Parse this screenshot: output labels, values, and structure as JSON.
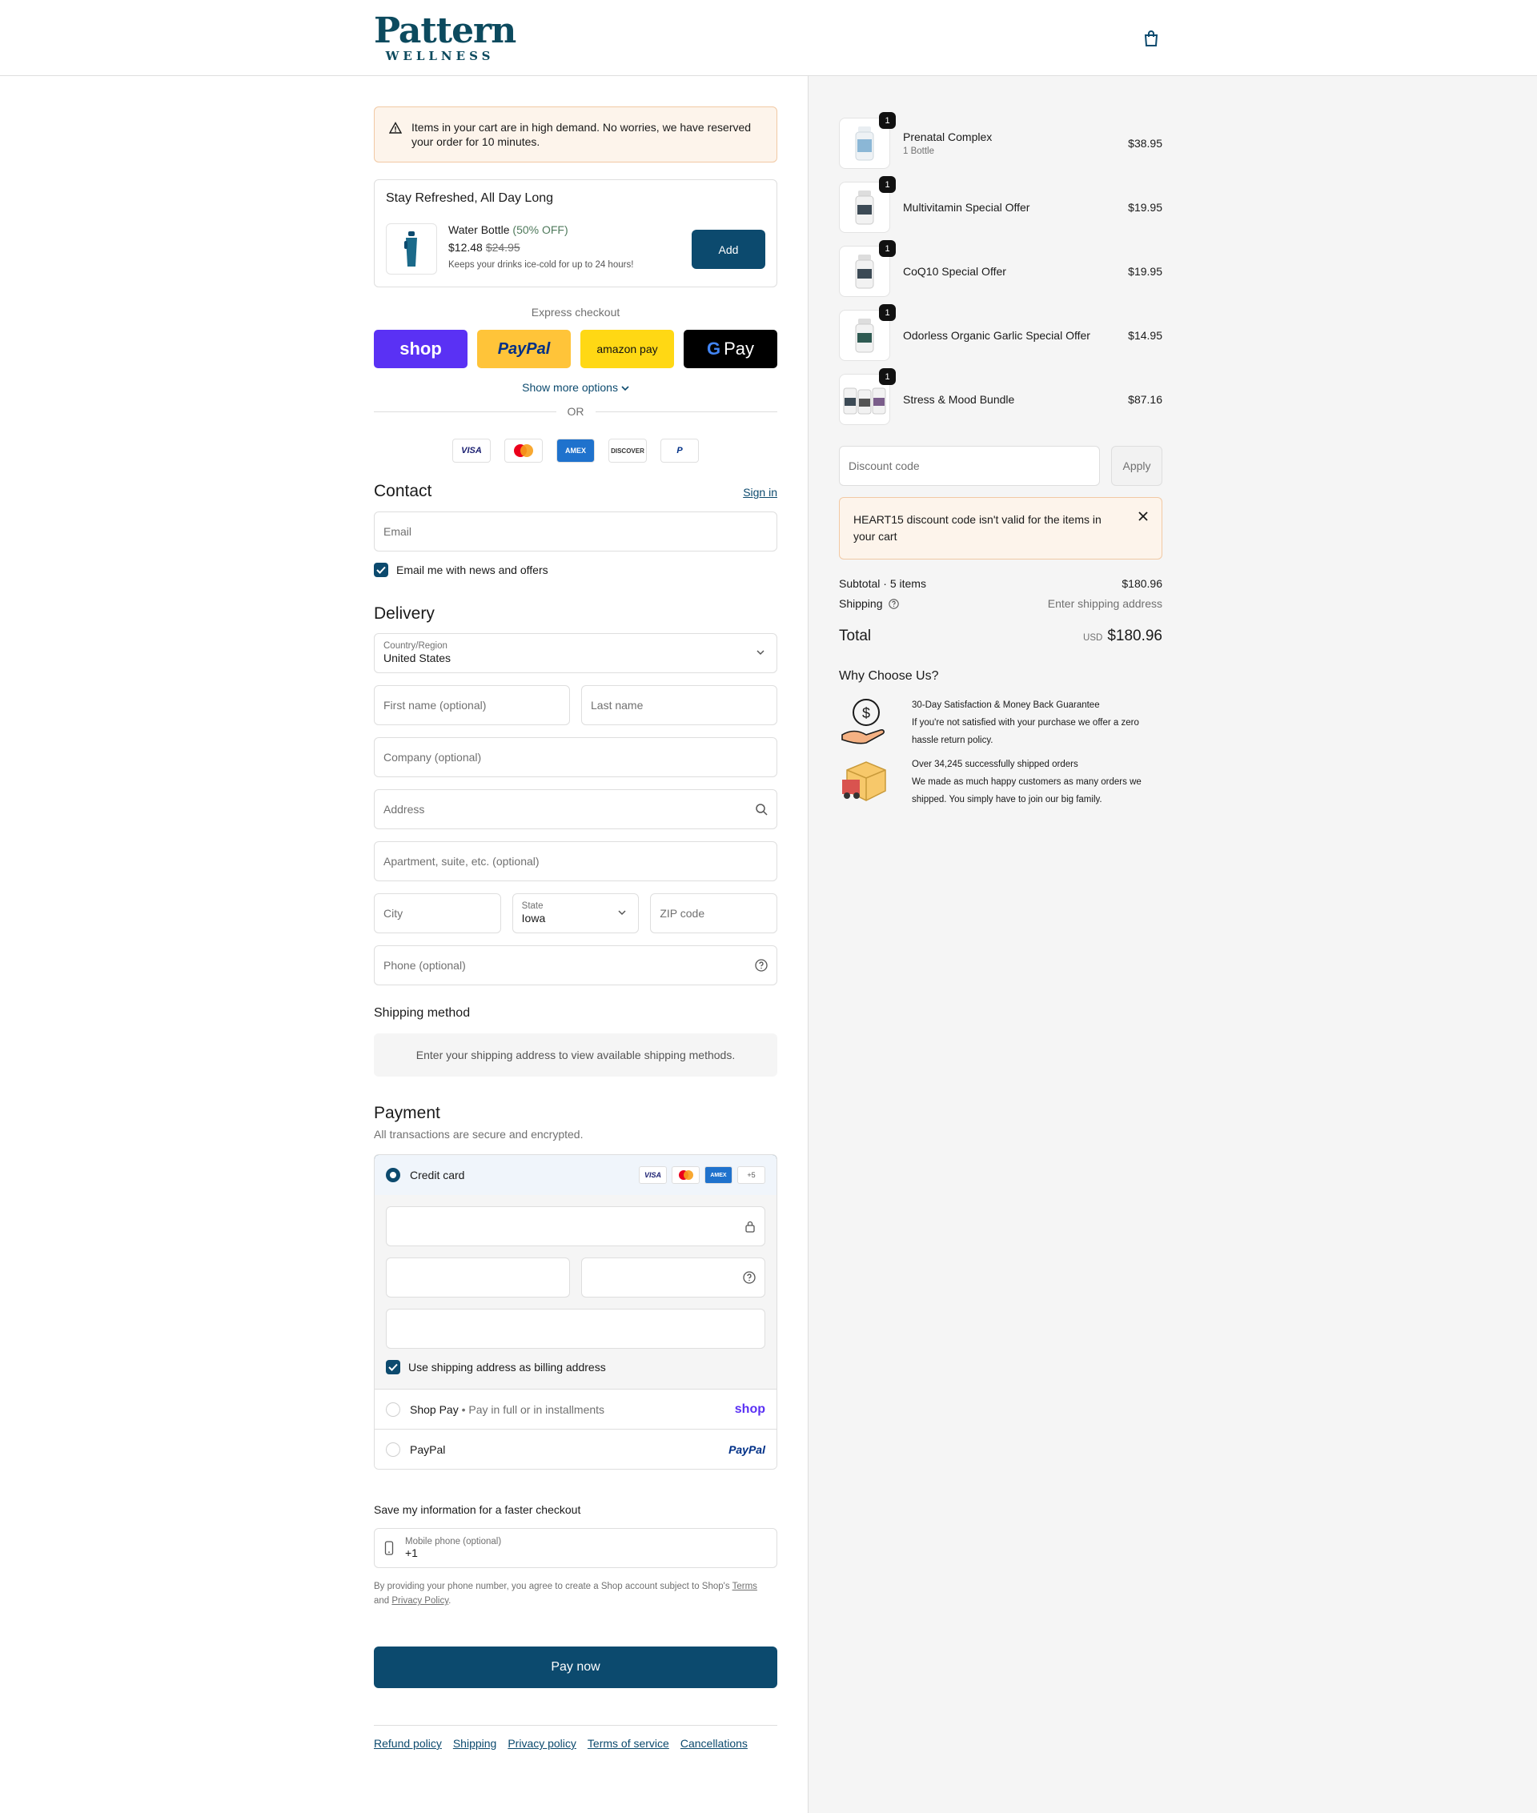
{
  "header": {
    "logo_main": "Pattern",
    "logo_sub": "WELLNESS"
  },
  "demand_alert": "Items in your cart are in high demand. No worries, we have reserved your order for 10 minutes.",
  "upsell": {
    "title": "Stay Refreshed, All Day Long",
    "name": "Water Bottle",
    "discount": "(50% OFF)",
    "price": "$12.48",
    "compare_price": "$24.95",
    "description": "Keeps your drinks ice-cold for up to 24 hours!",
    "add_label": "Add"
  },
  "express": {
    "label": "Express checkout",
    "shop": "shop",
    "paypal": "PayPal",
    "amazon": "amazon pay",
    "gpay": "Pay",
    "show_more": "Show more options",
    "or": "OR"
  },
  "card_logos": [
    "VISA",
    "MC",
    "AMEX",
    "DISCOVER",
    "P"
  ],
  "contact": {
    "title": "Contact",
    "sign_in": "Sign in",
    "email_placeholder": "Email",
    "newsletter": "Email me with news and offers"
  },
  "delivery": {
    "title": "Delivery",
    "country_label": "Country/Region",
    "country": "United States",
    "first_name": "First name (optional)",
    "last_name": "Last name",
    "company": "Company (optional)",
    "address": "Address",
    "apartment": "Apartment, suite, etc. (optional)",
    "city": "City",
    "state_label": "State",
    "state": "Iowa",
    "zip": "ZIP code",
    "phone": "Phone (optional)"
  },
  "shipping_method": {
    "title": "Shipping method",
    "message": "Enter your shipping address to view available shipping methods."
  },
  "payment": {
    "title": "Payment",
    "subtitle": "All transactions are secure and encrypted.",
    "credit_card": "Credit card",
    "more_cards": "+5",
    "billing_same": "Use shipping address as billing address",
    "shop_pay": "Shop Pay",
    "shop_pay_desc": "Pay in full or in installments",
    "shop_logo": "shop",
    "paypal": "PayPal",
    "paypal_logo": "PayPal"
  },
  "save_info": {
    "title": "Save my information for a faster checkout",
    "phone_label": "Mobile phone (optional)",
    "phone_value": "+1",
    "fine_prefix": "By providing your phone number, you agree to create a Shop account subject to Shop's",
    "terms": "Terms",
    "and": "and",
    "privacy": "Privacy Policy",
    "period": "."
  },
  "pay_now": "Pay now",
  "footer_links": [
    "Refund policy",
    "Shipping",
    "Privacy policy",
    "Terms of service",
    "Cancellations"
  ],
  "cart": {
    "items": [
      {
        "name": "Prenatal Complex",
        "variant": "1 Bottle",
        "price": "$38.95",
        "qty": "1"
      },
      {
        "name": "Multivitamin Special Offer",
        "variant": "",
        "price": "$19.95",
        "qty": "1"
      },
      {
        "name": "CoQ10 Special Offer",
        "variant": "",
        "price": "$19.95",
        "qty": "1"
      },
      {
        "name": "Odorless Organic Garlic Special Offer",
        "variant": "",
        "price": "$14.95",
        "qty": "1"
      },
      {
        "name": "Stress & Mood Bundle",
        "variant": "",
        "price": "$87.16",
        "qty": "1"
      }
    ],
    "discount_placeholder": "Discount code",
    "apply": "Apply",
    "discount_error": "HEART15 discount code isn't valid for the items in your cart",
    "subtotal_label": "Subtotal · 5 items",
    "subtotal": "$180.96",
    "shipping_label": "Shipping",
    "shipping_value": "Enter shipping address",
    "total_label": "Total",
    "currency": "USD",
    "total": "$180.96"
  },
  "why": {
    "title": "Why Choose Us?",
    "items": [
      {
        "heading": "30-Day Satisfaction & Money Back Guarantee",
        "body": "If you're not satisfied with your purchase we offer a zero hassle return policy."
      },
      {
        "heading": "Over 34,245 successfully shipped orders",
        "body": "We made as much happy customers as many orders we shipped. You simply have to join our big family."
      }
    ]
  },
  "colors": {
    "brand": "#0c4a6e",
    "alert_bg": "#fdf4eb",
    "shop_purple": "#5a31f4",
    "paypal_yellow": "#ffc439"
  }
}
